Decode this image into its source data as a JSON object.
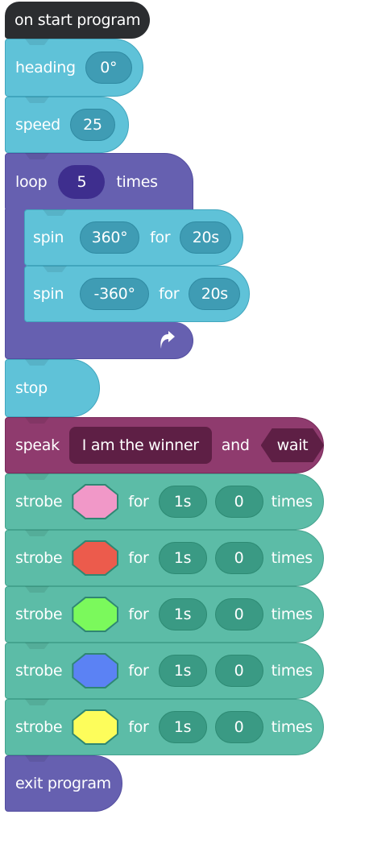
{
  "program": {
    "start_label": "on start program",
    "heading": {
      "label": "heading",
      "value": "0°"
    },
    "speed": {
      "label": "speed",
      "value": "25"
    },
    "loop": {
      "label": "loop",
      "count": "5",
      "suffix": "times",
      "repeat_icon": "loop-return-arrow-icon"
    },
    "spin1": {
      "label": "spin",
      "angle": "360°",
      "for": "for",
      "duration": "20s"
    },
    "spin2": {
      "label": "spin",
      "angle": "-360°",
      "for": "for",
      "duration": "20s"
    },
    "stop_label": "stop",
    "speak": {
      "label": "speak",
      "text": "I am the winner",
      "and": "and",
      "mode": "wait"
    },
    "strobes": [
      {
        "label": "strobe",
        "color": "#f198c8",
        "for": "for",
        "duration": "1s",
        "count": "0",
        "suffix": "times"
      },
      {
        "label": "strobe",
        "color": "#ec5b4c",
        "for": "for",
        "duration": "1s",
        "count": "0",
        "suffix": "times"
      },
      {
        "label": "strobe",
        "color": "#7bf95c",
        "for": "for",
        "duration": "1s",
        "count": "0",
        "suffix": "times"
      },
      {
        "label": "strobe",
        "color": "#5b82f4",
        "for": "for",
        "duration": "1s",
        "count": "0",
        "suffix": "times"
      },
      {
        "label": "strobe",
        "color": "#fdfd5b",
        "for": "for",
        "duration": "1s",
        "count": "0",
        "suffix": "times"
      }
    ],
    "exit_label": "exit program"
  },
  "colors": {
    "start": "#2b2d30",
    "motion": "#5fc2d8",
    "loop": "#6660b0",
    "speak": "#8f3b6e",
    "lights": "#5cbca7"
  }
}
